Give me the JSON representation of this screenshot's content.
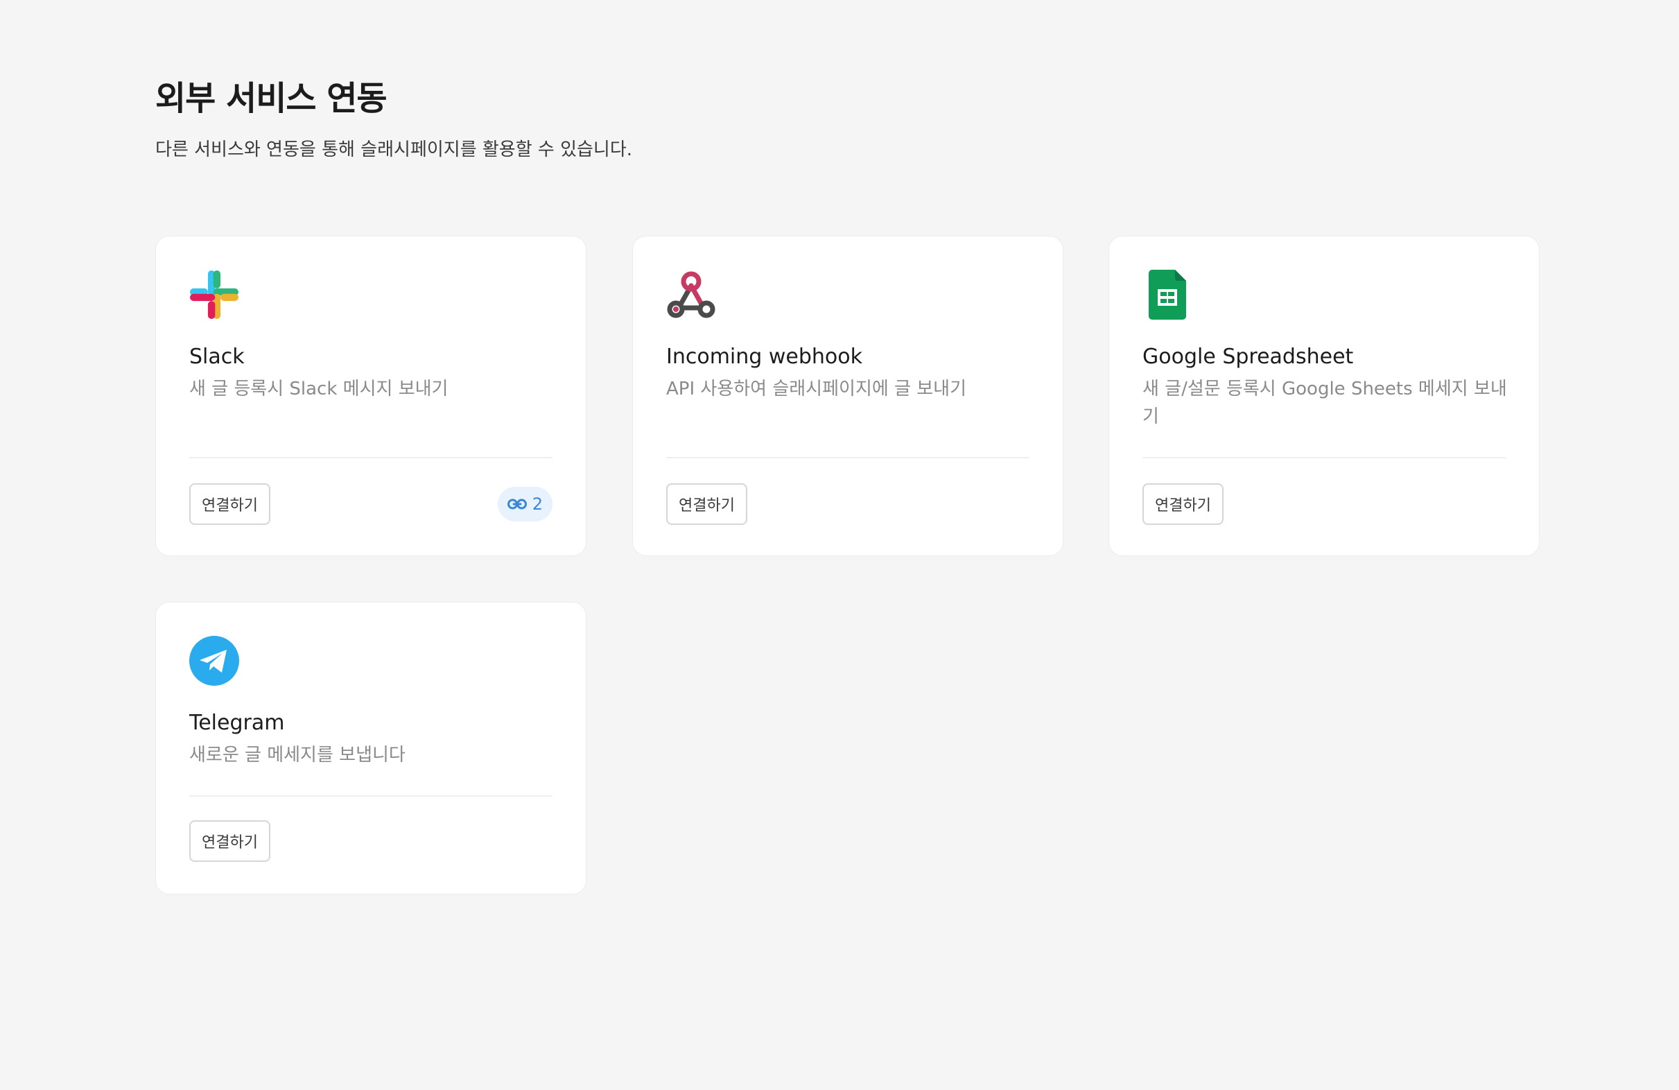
{
  "header": {
    "title": "외부 서비스 연동",
    "subtitle": "다른 서비스와 연동을 통해 슬래시페이지를 활용할 수 있습니다."
  },
  "integrations": [
    {
      "name": "Slack",
      "description": "새 글 등록시 Slack 메시지 보내기",
      "connect_label": "연결하기",
      "icon": "slack-logo-icon",
      "connection_count": "2"
    },
    {
      "name": "Incoming webhook",
      "description": "API 사용하여 슬래시페이지에 글 보내기",
      "connect_label": "연결하기",
      "icon": "webhook-logo-icon"
    },
    {
      "name": "Google Spreadsheet",
      "description": "새 글/설문 등록시 Google Sheets 메세지 보내기",
      "connect_label": "연결하기",
      "icon": "google-sheets-logo-icon"
    },
    {
      "name": "Telegram",
      "description": "새로운 글 메세지를 보냅니다",
      "connect_label": "연결하기",
      "icon": "telegram-logo-icon"
    }
  ],
  "colors": {
    "background": "#f5f5f5",
    "card": "#ffffff",
    "badge_bg": "#e7f2fd",
    "badge_text": "#3b86d8",
    "slack_blue": "#36c5f0",
    "slack_green": "#2eb67d",
    "slack_red": "#e01e5a",
    "slack_yellow": "#ecb22e",
    "webhook_red": "#c73a63",
    "webhook_gray": "#4b4b4b",
    "sheets_green": "#0f9d58",
    "telegram_blue": "#2aabee"
  }
}
